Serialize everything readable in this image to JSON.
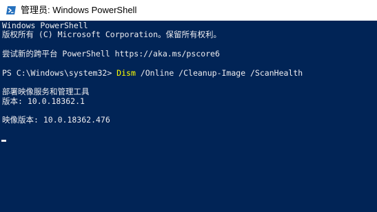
{
  "window": {
    "title": "管理员: Windows PowerShell"
  },
  "console": {
    "header_line1": "Windows PowerShell",
    "header_line2": "版权所有 (C) Microsoft Corporation。保留所有权利。",
    "hint_line": "尝试新的跨平台 PowerShell https://aka.ms/pscore6",
    "prompt": "PS C:\\Windows\\system32> ",
    "command_name": "Dism",
    "command_args": " /Online /Cleanup-Image /ScanHealth",
    "tool_title": "部署映像服务和管理工具",
    "tool_version": "版本: 10.0.18362.1",
    "image_version": "映像版本: 10.0.18362.476"
  },
  "colors": {
    "console_background": "#012456",
    "console_text": "#eeedf0",
    "command_highlight": "#ffff00",
    "titlebar_background": "#ffffff"
  },
  "icons": {
    "app_icon": "powershell-icon"
  }
}
